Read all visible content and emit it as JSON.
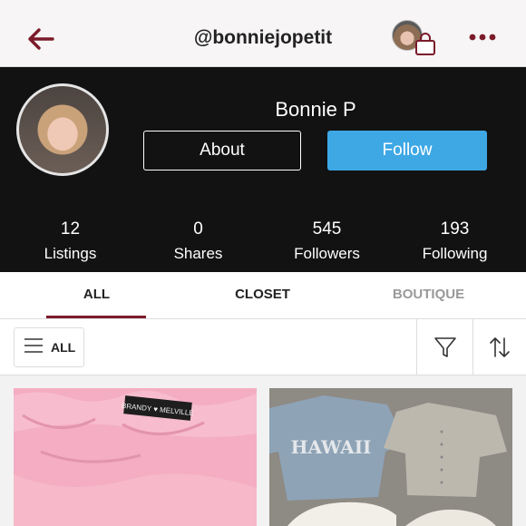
{
  "header": {
    "username": "@bonniejopetit",
    "back_icon": "back-arrow-icon",
    "bag_icon": "shopping-bag-icon",
    "more_icon": "more-dots-icon"
  },
  "profile": {
    "name": "Bonnie P",
    "about_label": "About",
    "follow_label": "Follow",
    "stats": [
      {
        "value": "12",
        "label": "Listings"
      },
      {
        "value": "0",
        "label": "Shares"
      },
      {
        "value": "545",
        "label": "Followers"
      },
      {
        "value": "193",
        "label": "Following"
      }
    ]
  },
  "tabs": [
    {
      "label": "ALL",
      "active": true
    },
    {
      "label": "CLOSET",
      "active": false
    },
    {
      "label": "BOUTIQUE",
      "active": false
    }
  ],
  "filters": {
    "all_label": "ALL",
    "filter_icon": "filter-funnel-icon",
    "sort_icon": "sort-arrows-icon"
  },
  "listings": [
    {
      "brand_tag": "BRANDY ♥ MELVILLE"
    },
    {
      "shirt_text": "HAWAII"
    }
  ],
  "colors": {
    "accent": "#7b1b2a",
    "follow": "#3ea8e5",
    "profile_bg": "#121212"
  }
}
